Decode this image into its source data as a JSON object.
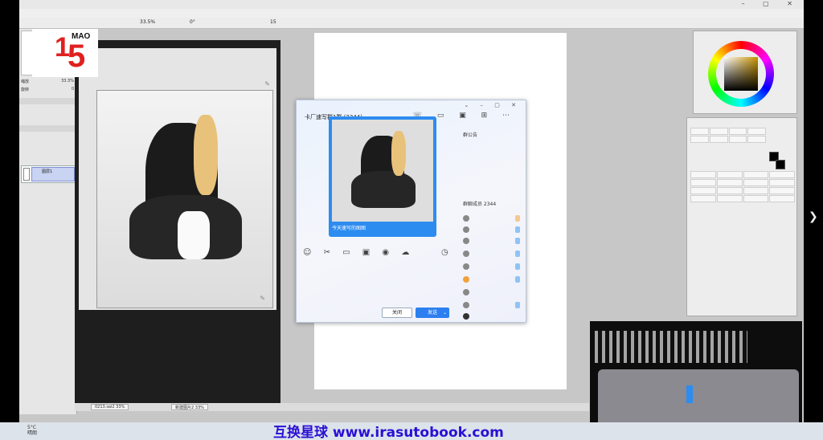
{
  "logo": {
    "number_1": "1",
    "number_5": "5",
    "brand": "MAO"
  },
  "toolbar": {
    "zoom": "33.5%",
    "angle": "0°",
    "stabilizer": "15"
  },
  "left_panel": {
    "rows": [
      {
        "label": "缩放",
        "value": "33.3%"
      },
      {
        "label": "旋转",
        "value": "0"
      }
    ],
    "layer_label": "图层1"
  },
  "chat": {
    "title": "卡厂速写群1群 (2344)",
    "caption": "今天速写的图图",
    "announce": "群公告",
    "members_title": "群聊成员 2344",
    "close": "关闭",
    "send": "发送"
  },
  "tabs": [
    {
      "label": "0213.sai2",
      "zoom": "33%"
    },
    {
      "label": "新建图片2",
      "zoom": "33%"
    }
  ],
  "taskbar": {
    "temp": "5°C",
    "weather": "晴朗"
  },
  "banner": "互换星球 www.irasutobook.com",
  "icons": [
    "search-icon",
    "close-icon",
    "minimize-icon",
    "chevron-right-icon",
    "arrow-right-icon"
  ]
}
